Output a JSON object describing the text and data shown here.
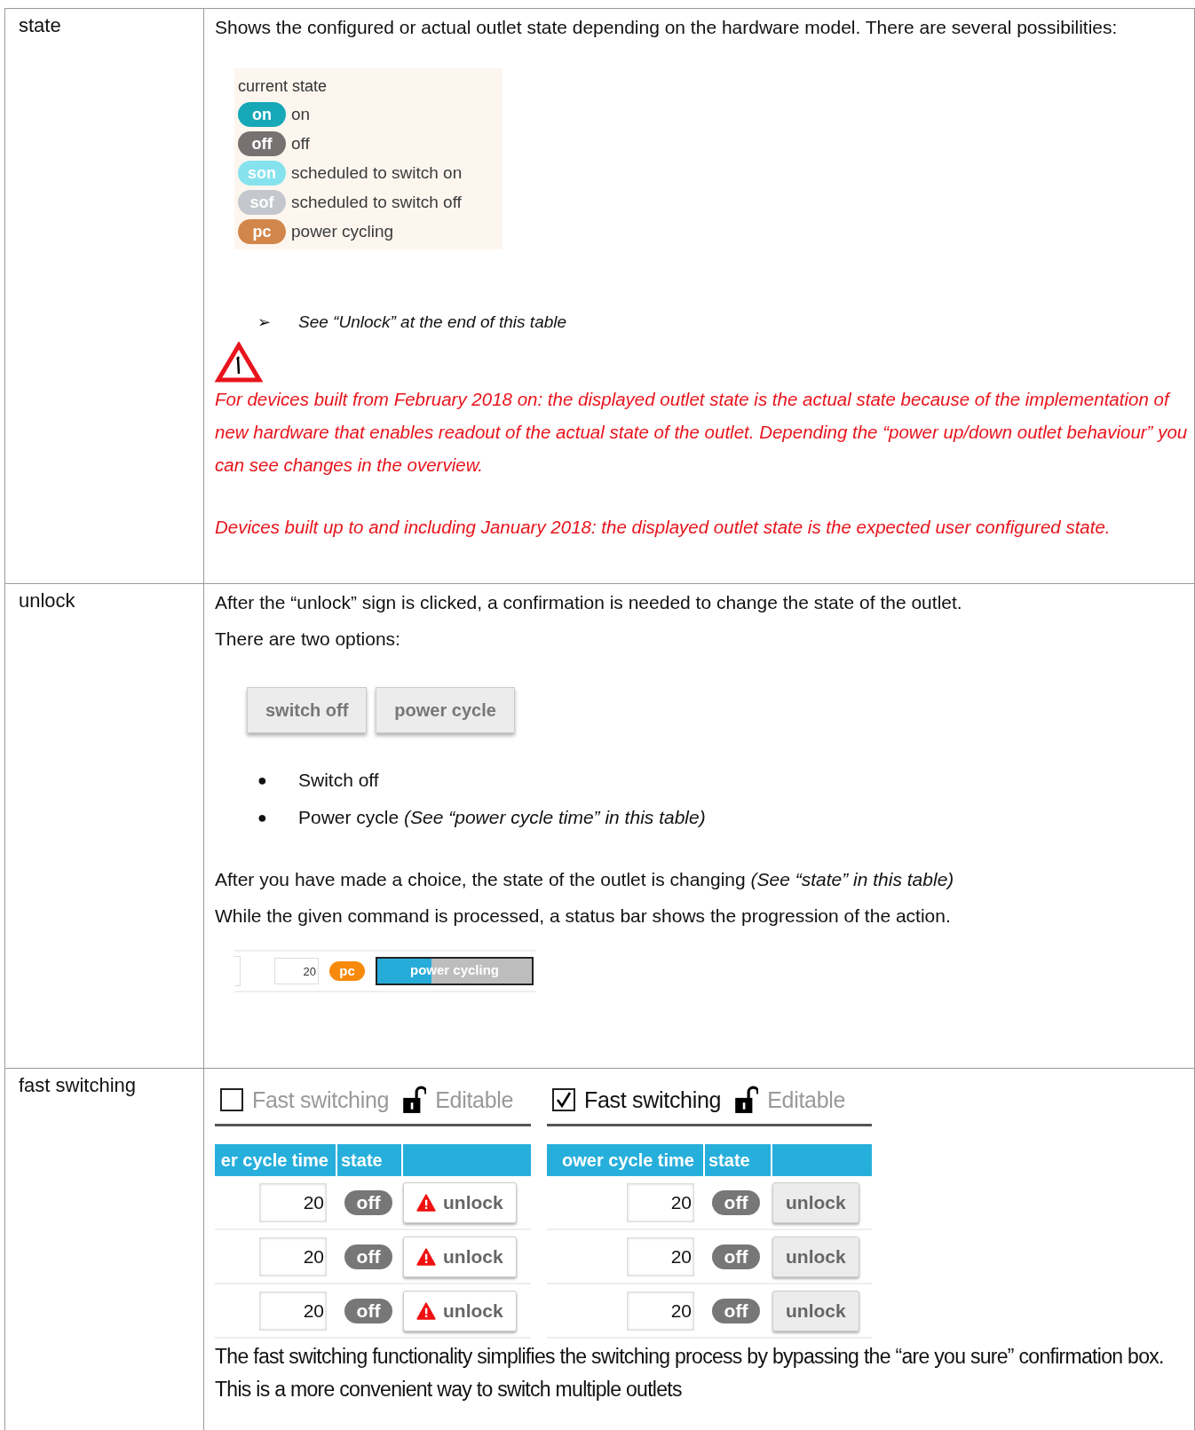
{
  "rows": [
    {
      "term": "state",
      "blocks": [
        {
          "kind": "paragraph",
          "text": "Shows the configured or actual outlet state depending on the hardware model. There are several possibilities:"
        },
        {
          "kind": "legend",
          "title": "current state",
          "items": [
            {
              "badge": "on",
              "label": "on",
              "color": "#17a8b8"
            },
            {
              "badge": "off",
              "label": "off",
              "color": "#777172"
            },
            {
              "badge": "son",
              "label": "scheduled to switch on",
              "color": "#86e3ee"
            },
            {
              "badge": "sof",
              "label": "scheduled to switch off",
              "color": "#c4c8ce"
            },
            {
              "badge": "pc",
              "label": "power cycling",
              "color": "#d2864a"
            }
          ]
        },
        {
          "kind": "arrow_note",
          "marker": "➢",
          "text": "See “Unlock” at the end of this table"
        },
        {
          "kind": "warning"
        },
        {
          "kind": "alert",
          "text": "For devices built from February 2018 on: the displayed outlet state is the actual state because of the implementation of new hardware that enables readout of the actual state of the outlet. Depending the “power up/down outlet behaviour” you can see changes in the overview."
        },
        {
          "kind": "alert",
          "text": "Devices built up to and including January 2018: the displayed outlet state is the expected user configured state."
        }
      ]
    },
    {
      "term": "unlock",
      "blocks": [
        {
          "kind": "paragraph",
          "text": "After the “unlock” sign is clicked, a confirmation is needed to change the state of the outlet."
        },
        {
          "kind": "paragraph",
          "text": "There are two options:"
        },
        {
          "kind": "buttons",
          "labels": [
            "switch off",
            "power cycle"
          ]
        },
        {
          "kind": "bullets",
          "marker": "●",
          "items": [
            "Switch off",
            "Power cycle *(See “power cycle time” in  this table)*"
          ]
        },
        {
          "kind": "paragraph",
          "text": "After you have made a choice, the state of the outlet is changing *(See “state” in  this table)*"
        },
        {
          "kind": "paragraph",
          "text": "While the given command is processed, a status bar shows the progression of the action."
        },
        {
          "kind": "progress",
          "value": "20",
          "badge": "pc",
          "color": "#f78a0c",
          "label": "power cycling",
          "level": 0.35
        }
      ]
    },
    {
      "term": "fast switching",
      "blocks": [
        {
          "kind": "fast_panels",
          "panels": [
            {
              "checked": false,
              "label": "Fast switching",
              "lock_label": "Editable",
              "columns": [
                "er cycle time",
                "state"
              ],
              "rows": [
                {
                  "value": "20",
                  "state": "off",
                  "button": "unlock",
                  "warning": true
                },
                {
                  "value": "20",
                  "state": "off",
                  "button": "unlock",
                  "warning": true
                },
                {
                  "value": "20",
                  "state": "off",
                  "button": "unlock",
                  "warning": true
                }
              ]
            },
            {
              "checked": true,
              "label": "Fast switching",
              "lock_label": "Editable",
              "columns": [
                "ower cycle time",
                "state"
              ],
              "rows": [
                {
                  "value": "20",
                  "state": "off",
                  "button": "unlock",
                  "warning": false
                },
                {
                  "value": "20",
                  "state": "off",
                  "button": "unlock",
                  "warning": false
                },
                {
                  "value": "20",
                  "state": "off",
                  "button": "unlock",
                  "warning": false
                }
              ]
            }
          ]
        },
        {
          "kind": "note",
          "text": "The fast switching functionality simplifies the switching process by bypassing the “are you sure” confirmation box. This is a more convenient way to switch multiple outlets"
        }
      ]
    }
  ]
}
